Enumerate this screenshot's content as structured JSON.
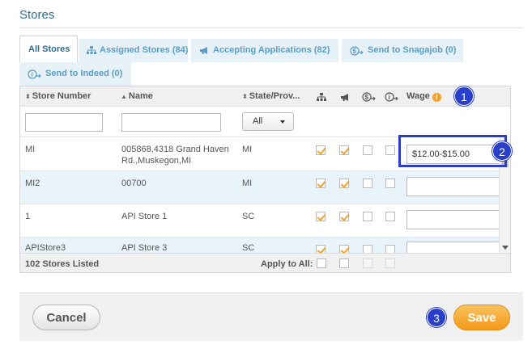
{
  "page": {
    "title": "Stores"
  },
  "tabs": [
    {
      "label": "All Stores",
      "icon": "none",
      "active": true
    },
    {
      "label": "Assigned Stores (84)",
      "icon": "hierarchy-icon"
    },
    {
      "label": "Accepting Applications (82)",
      "icon": "megaphone-icon"
    },
    {
      "label": "Send to Snagajob (0)",
      "icon": "send-snagajob-icon"
    },
    {
      "label": "Send to Indeed (0)",
      "icon": "send-indeed-icon"
    }
  ],
  "grid": {
    "columns": {
      "store_number": "Store Number",
      "name": "Name",
      "state": "State/Prov...",
      "wage": "Wage"
    },
    "state_filter": "All",
    "rows": [
      {
        "store_number": "MI",
        "name": "005868,4318 Grand Haven Rd.,Muskegon,MI",
        "state": "MI",
        "assigned": true,
        "accepting": true,
        "snagajob": false,
        "indeed": false,
        "wage": "$12.00-$15.00"
      },
      {
        "store_number": "MI2",
        "name": "00700",
        "state": "MI",
        "assigned": true,
        "accepting": true,
        "snagajob": false,
        "indeed": false,
        "wage": ""
      },
      {
        "store_number": "1",
        "name": "API Store 1",
        "state": "SC",
        "assigned": true,
        "accepting": true,
        "snagajob": false,
        "indeed": false,
        "wage": ""
      },
      {
        "store_number": "APIStore3",
        "name": "API Store 3",
        "state": "SC",
        "assigned": true,
        "accepting": true,
        "snagajob": false,
        "indeed": false,
        "wage": ""
      }
    ],
    "footer": {
      "count_label": "102 Stores Listed",
      "apply_all_label": "Apply to All:"
    }
  },
  "actions": {
    "cancel_label": "Cancel",
    "save_label": "Save"
  },
  "callouts": [
    "1",
    "2",
    "3"
  ],
  "colors": {
    "accent": "#2f6d8f",
    "tab_link": "#5a9dc5",
    "save": "#f29a1a",
    "callout": "#2a3fc9",
    "row_alt": "#e8f3fa"
  }
}
